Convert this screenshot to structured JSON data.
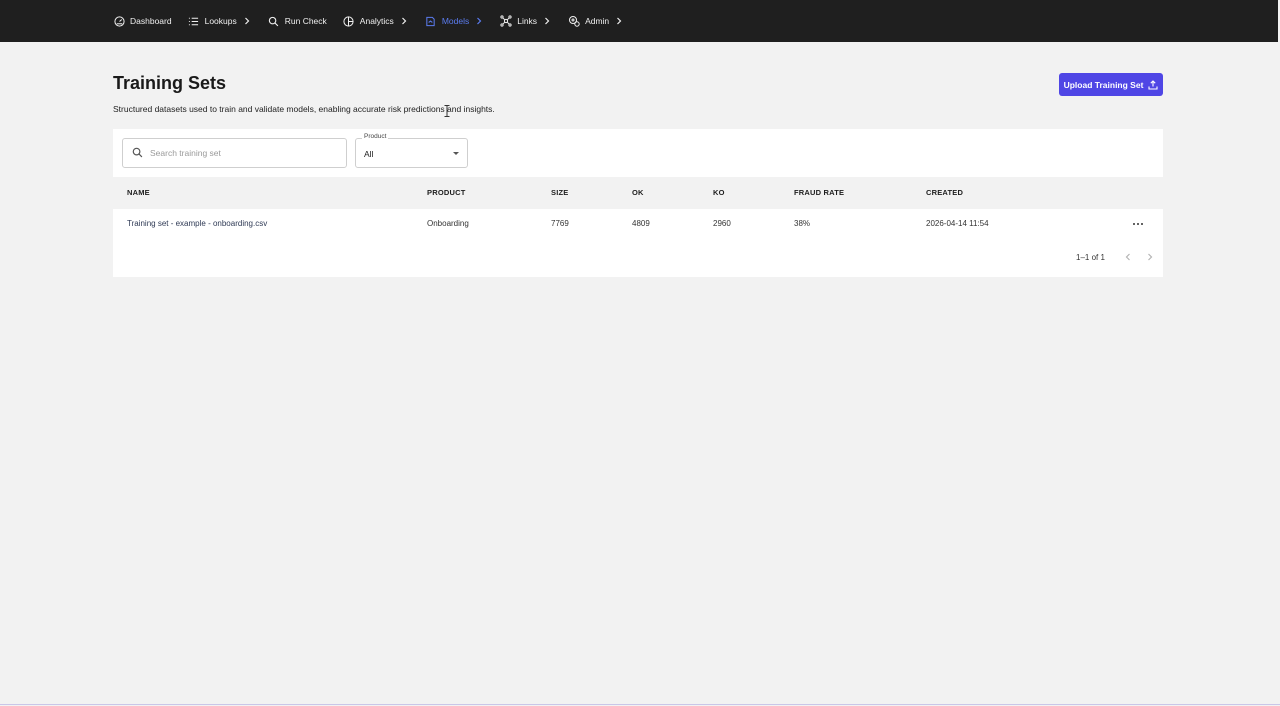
{
  "nav": {
    "items": [
      {
        "label": "Dashboard",
        "icon": "gauge-icon",
        "has_chevron": false,
        "active": false
      },
      {
        "label": "Lookups",
        "icon": "list-icon",
        "has_chevron": true,
        "active": false
      },
      {
        "label": "Run Check",
        "icon": "search-icon",
        "has_chevron": false,
        "active": false
      },
      {
        "label": "Analytics",
        "icon": "pie-chart-icon",
        "has_chevron": true,
        "active": false
      },
      {
        "label": "Models",
        "icon": "model-icon",
        "has_chevron": true,
        "active": true
      },
      {
        "label": "Links",
        "icon": "network-icon",
        "has_chevron": true,
        "active": false
      },
      {
        "label": "Admin",
        "icon": "admin-gears-icon",
        "has_chevron": true,
        "active": false
      }
    ]
  },
  "header": {
    "title": "Training Sets",
    "description": "Structured datasets used to train and validate models, enabling accurate risk predictions and insights.",
    "upload_label": "Upload Training Set"
  },
  "filters": {
    "search_placeholder": "Search training set",
    "product_label": "Product",
    "product_value": "All"
  },
  "table": {
    "columns": [
      "NAME",
      "PRODUCT",
      "SIZE",
      "OK",
      "KO",
      "FRAUD RATE",
      "CREATED"
    ],
    "rows": [
      {
        "name": "Training set - example - onboarding.csv",
        "product": "Onboarding",
        "size": "7769",
        "ok": "4809",
        "ko": "2960",
        "fraud_rate": "38%",
        "created": "2026-04-14 11:54"
      }
    ]
  },
  "pagination": {
    "range_text": "1–1 of 1"
  },
  "colors": {
    "topbar": "#1f1f1f",
    "accent": "#4f46e5",
    "active_nav": "#5b7cf0",
    "background": "#f2f2f2"
  }
}
